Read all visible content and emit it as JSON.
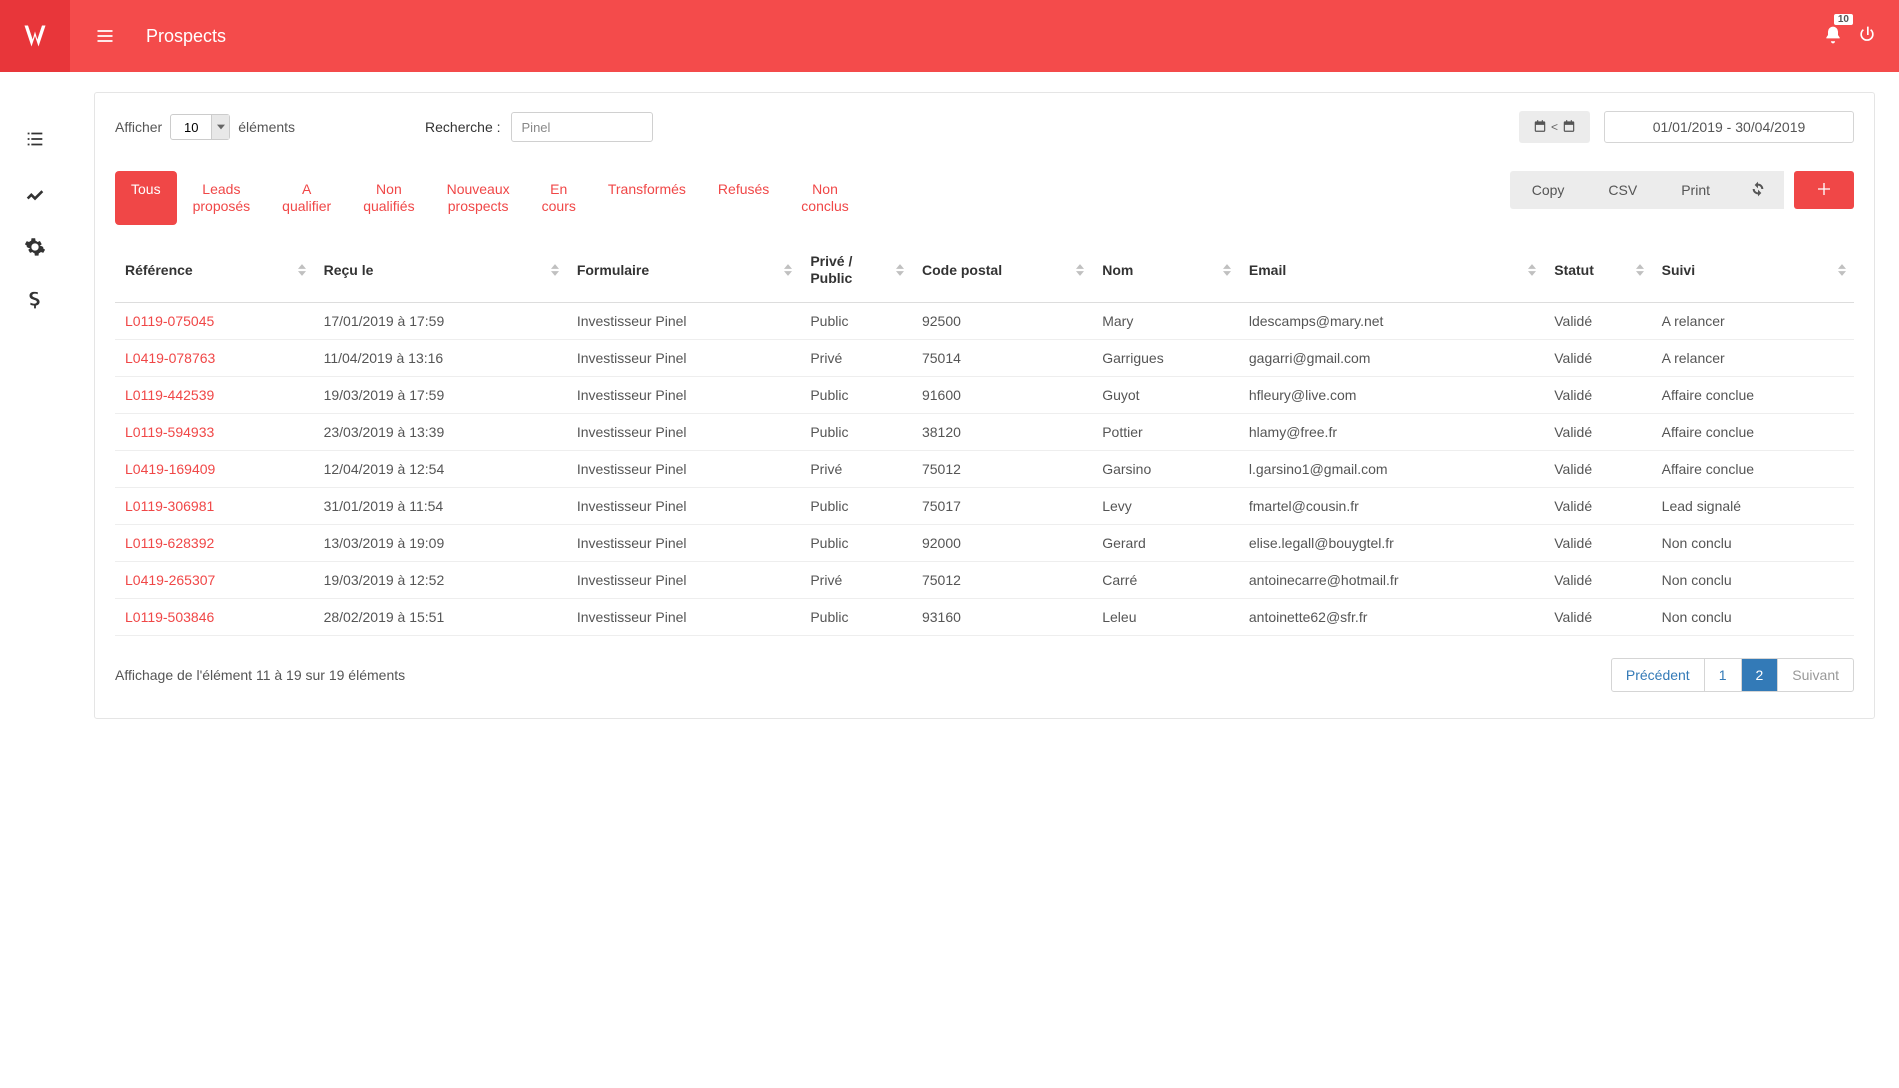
{
  "header": {
    "title": "Prospects",
    "notifications_count": "10"
  },
  "controls": {
    "show_prefix": "Afficher",
    "page_length": "10",
    "show_suffix": "éléments",
    "search_label": "Recherche :",
    "search_value": "Pinel",
    "date_range": "01/01/2019 - 30/04/2019"
  },
  "tabs": [
    "Tous",
    "Leads proposés",
    "A qualifier",
    "Non qualifiés",
    "Nouveaux prospects",
    "En cours",
    "Transformés",
    "Refusés",
    "Non conclus"
  ],
  "actions": {
    "copy": "Copy",
    "csv": "CSV",
    "print": "Print"
  },
  "columns": [
    "Référence",
    "Reçu le",
    "Formulaire",
    "Privé / Public",
    "Code postal",
    "Nom",
    "Email",
    "Statut",
    "Suivi"
  ],
  "rows": [
    {
      "ref": "L0119-075045",
      "recu": "17/01/2019 à 17:59",
      "form": "Investisseur Pinel",
      "priv": "Public",
      "cp": "92500",
      "nom": "Mary",
      "email": "ldescamps@mary.net",
      "statut": "Validé",
      "suivi": "A relancer"
    },
    {
      "ref": "L0419-078763",
      "recu": "11/04/2019 à 13:16",
      "form": "Investisseur Pinel",
      "priv": "Privé",
      "cp": "75014",
      "nom": "Garrigues",
      "email": "gagarri@gmail.com",
      "statut": "Validé",
      "suivi": "A relancer"
    },
    {
      "ref": "L0119-442539",
      "recu": "19/03/2019 à 17:59",
      "form": "Investisseur Pinel",
      "priv": "Public",
      "cp": "91600",
      "nom": "Guyot",
      "email": "hfleury@live.com",
      "statut": "Validé",
      "suivi": "Affaire conclue"
    },
    {
      "ref": "L0119-594933",
      "recu": "23/03/2019 à 13:39",
      "form": "Investisseur Pinel",
      "priv": "Public",
      "cp": "38120",
      "nom": "Pottier",
      "email": "hlamy@free.fr",
      "statut": "Validé",
      "suivi": "Affaire conclue"
    },
    {
      "ref": "L0419-169409",
      "recu": "12/04/2019 à 12:54",
      "form": "Investisseur Pinel",
      "priv": "Privé",
      "cp": "75012",
      "nom": "Garsino",
      "email": "l.garsino1@gmail.com",
      "statut": "Validé",
      "suivi": "Affaire conclue"
    },
    {
      "ref": "L0119-306981",
      "recu": "31/01/2019 à 11:54",
      "form": "Investisseur Pinel",
      "priv": "Public",
      "cp": "75017",
      "nom": "Levy",
      "email": "fmartel@cousin.fr",
      "statut": "Validé",
      "suivi": "Lead signalé"
    },
    {
      "ref": "L0119-628392",
      "recu": "13/03/2019 à 19:09",
      "form": "Investisseur Pinel",
      "priv": "Public",
      "cp": "92000",
      "nom": "Gerard",
      "email": "elise.legall@bouygtel.fr",
      "statut": "Validé",
      "suivi": "Non conclu"
    },
    {
      "ref": "L0419-265307",
      "recu": "19/03/2019 à 12:52",
      "form": "Investisseur Pinel",
      "priv": "Privé",
      "cp": "75012",
      "nom": "Carré",
      "email": "antoinecarre@hotmail.fr",
      "statut": "Validé",
      "suivi": "Non conclu"
    },
    {
      "ref": "L0119-503846",
      "recu": "28/02/2019 à 15:51",
      "form": "Investisseur Pinel",
      "priv": "Public",
      "cp": "93160",
      "nom": "Leleu",
      "email": "antoinette62@sfr.fr",
      "statut": "Validé",
      "suivi": "Non conclu"
    }
  ],
  "footer": {
    "info": "Affichage de l'élément 11 à 19 sur 19 éléments",
    "prev": "Précédent",
    "next": "Suivant",
    "pages": [
      "1",
      "2"
    ],
    "active_page": "2"
  }
}
